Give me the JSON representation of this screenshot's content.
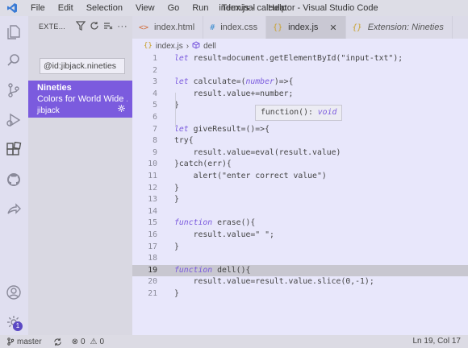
{
  "window": {
    "title": "index.js - calculator - Visual Studio Code"
  },
  "menu": [
    "File",
    "Edit",
    "Selection",
    "View",
    "Go",
    "Run",
    "Terminal",
    "Help"
  ],
  "sidebar": {
    "header": "EXTE...",
    "search_value": "@id:jibjack.nineties",
    "extension": {
      "name": "Nineties",
      "description": "Colors for World Wide ...",
      "author": "jibjack"
    }
  },
  "tabs": [
    {
      "label": "index.html",
      "icon": "html-icon"
    },
    {
      "label": "index.css",
      "icon": "css-icon"
    },
    {
      "label": "index.js",
      "icon": "js-icon",
      "active": true
    },
    {
      "label": "Extension: Nineties",
      "icon": "extension-icon"
    }
  ],
  "breadcrumb": {
    "file": "index.js",
    "symbol": "dell"
  },
  "hover": {
    "prefix": "function(): ",
    "type": "void"
  },
  "code": [
    {
      "n": "1",
      "tokens": [
        [
          "kw",
          "let"
        ],
        [
          "t",
          " result=document.getElementById(\"input-txt\");"
        ]
      ]
    },
    {
      "n": "2",
      "tokens": []
    },
    {
      "n": "3",
      "tokens": [
        [
          "kw",
          "let"
        ],
        [
          "t",
          " calculate=("
        ],
        [
          "kw",
          "number"
        ],
        [
          "t",
          ")=>{"
        ]
      ]
    },
    {
      "n": "4",
      "tokens": [
        [
          "t",
          "    result.value+=number;"
        ]
      ]
    },
    {
      "n": "5",
      "tokens": [
        [
          "t",
          "}"
        ]
      ]
    },
    {
      "n": "6",
      "tokens": []
    },
    {
      "n": "7",
      "tokens": [
        [
          "kw",
          "let"
        ],
        [
          "t",
          " giveResult=()=>{"
        ]
      ]
    },
    {
      "n": "8",
      "tokens": [
        [
          "t",
          "try{"
        ]
      ]
    },
    {
      "n": "9",
      "tokens": [
        [
          "t",
          "    result.value=eval(result.value)"
        ]
      ]
    },
    {
      "n": "10",
      "tokens": [
        [
          "t",
          "}catch(err){"
        ]
      ]
    },
    {
      "n": "11",
      "tokens": [
        [
          "t",
          "    alert(\"enter correct value\")"
        ]
      ]
    },
    {
      "n": "12",
      "tokens": [
        [
          "t",
          "}"
        ]
      ]
    },
    {
      "n": "13",
      "tokens": [
        [
          "t",
          "}"
        ]
      ]
    },
    {
      "n": "14",
      "tokens": []
    },
    {
      "n": "15",
      "tokens": [
        [
          "kw",
          "function"
        ],
        [
          "t",
          " erase(){"
        ]
      ]
    },
    {
      "n": "16",
      "tokens": [
        [
          "t",
          "    result.value=\" \";"
        ]
      ]
    },
    {
      "n": "17",
      "tokens": [
        [
          "t",
          "}"
        ]
      ]
    },
    {
      "n": "18",
      "tokens": []
    },
    {
      "n": "19",
      "tokens": [
        [
          "kw",
          "function"
        ],
        [
          "t",
          " dell(){"
        ]
      ],
      "current": true
    },
    {
      "n": "20",
      "tokens": [
        [
          "t",
          "    result.value=result.value.slice(0,-1);"
        ]
      ]
    },
    {
      "n": "21",
      "tokens": [
        [
          "t",
          "}"
        ]
      ]
    }
  ],
  "status": {
    "branch": "master",
    "errors": "0",
    "warnings": "0",
    "position": "Ln 19, Col 17"
  },
  "colors": {
    "accent": "#7b5bde",
    "background": "#e8e7fb"
  }
}
